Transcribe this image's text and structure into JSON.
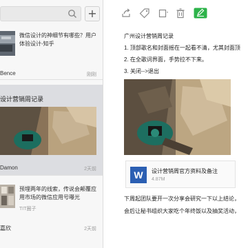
{
  "toolbar": {
    "search_placeholder": "",
    "add_label": "+",
    "icons": [
      "share-icon",
      "tag-icon",
      "window-icon",
      "trash-icon",
      "edit-icon"
    ],
    "edit_active_color": "#2db34a"
  },
  "notes": [
    {
      "snippet": "微信设计的神细节有哪些？用户体验设计-知乎",
      "author": "Bence",
      "date": "刚刚"
    },
    {
      "title": "设计营销周记录",
      "author": "Damon",
      "date": "2天前",
      "selected": true
    },
    {
      "snippet": "预埋两年的线索，传说会颠覆应用市场的微信应用号曝光",
      "source": "TIT圈子",
      "author": "嘉欣",
      "date": "2天前"
    }
  ],
  "detail": {
    "title": "广州设计营销周记录",
    "steps": [
      "1. 顶部歌名和封面摇在一起看不清，尤其封面顶",
      "2. 在全歌词界面，手势拉不下来。",
      "3. 关闭-->退出"
    ],
    "attachment": {
      "icon_letter": "W",
      "name": "设计营销周官方资料及备注",
      "size": "4.87M"
    },
    "paragraphs": [
      "下周起团队要开一次分享会研究一下以上结论，",
      "会后让秘书组织大家吃个年终饭以及抽奖活动，"
    ]
  },
  "colors": {
    "selected_bg": "#dcdde1",
    "word_blue": "#2b5fb3"
  }
}
